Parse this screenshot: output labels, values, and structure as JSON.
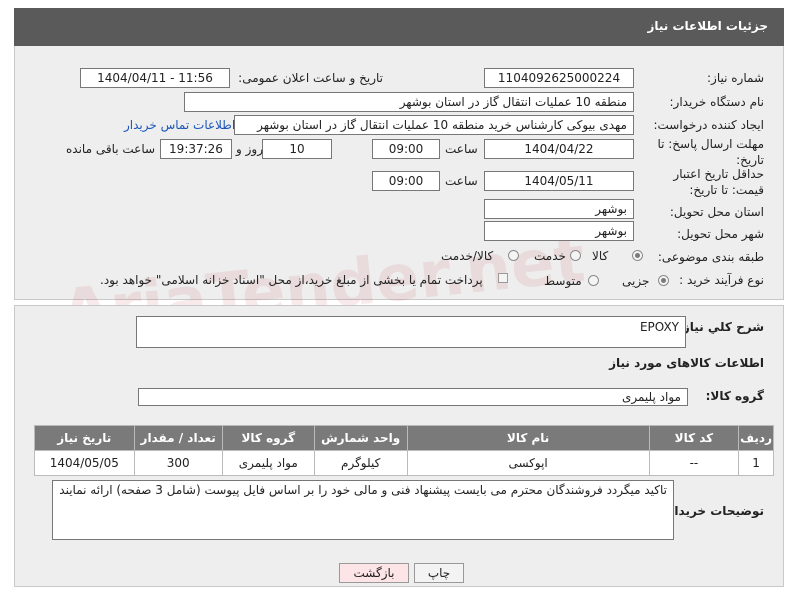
{
  "header": {
    "title": "جزئیات اطلاعات نیاز"
  },
  "form": {
    "need_number_label": "شماره نیاز:",
    "need_number": "1104092625000224",
    "announce_label": "تاریخ و ساعت اعلان عمومی:",
    "announce_value": "1404/04/11 - 11:56",
    "buyer_org_label": "نام دستگاه خریدار:",
    "buyer_org": "منطقه 10 عملیات انتقال گاز در استان بوشهر",
    "requester_label": "ایجاد کننده درخواست:",
    "requester": "مهدی بیوکی کارشناس خرید منطقه 10 عملیات انتقال گاز در استان بوشهر",
    "contact_link": "اطلاعات تماس خریدار",
    "reply_deadline_label": "مهلت ارسال پاسخ: تا تاریخ:",
    "reply_date": "1404/04/22",
    "time_label": "ساعت",
    "reply_time": "09:00",
    "days_value": "10",
    "days_label": "روز و",
    "remaining_time": "19:37:26",
    "remaining_label": "ساعت باقی مانده",
    "price_deadline_label": "حداقل تاریخ اعتبار قیمت: تا تاریخ:",
    "price_date": "1404/05/11",
    "price_time": "09:00",
    "province_label": "استان محل تحویل:",
    "province": "بوشهر",
    "city_label": "شهر محل تحویل:",
    "city": "بوشهر",
    "category_label": "طبقه بندی موضوعی:",
    "category_options": [
      "کالا",
      "خدمت",
      "کالا/خدمت"
    ],
    "process_label": "نوع فرآیند خرید :",
    "process_options": [
      "جزیی",
      "متوسط"
    ],
    "payment_note": "پرداخت تمام یا بخشی از مبلغ خرید،از محل \"اسناد خزانه اسلامی\" خواهد بود."
  },
  "summary": {
    "label": "شرح کلي نياز:",
    "value": "EPOXY"
  },
  "goods": {
    "section_title": "اطلاعات کالاهای مورد نیاز",
    "group_label": "گروه کالا:",
    "group_value": "مواد پلیمری",
    "columns": [
      "ردیف",
      "کد کالا",
      "نام کالا",
      "واحد شمارش",
      "گروه کالا",
      "تعداد / مقدار",
      "تاریخ نیاز"
    ],
    "rows": [
      [
        "1",
        "--",
        "اپوکسی",
        "کیلوگرم",
        "مواد پلیمری",
        "300",
        "1404/05/05"
      ]
    ]
  },
  "buyer_notes": {
    "label": "توضیحات خریدار:",
    "value": "تاکید میگردد فروشندگان محترم می بایست پیشنهاد فنی و مالی خود را بر اساس فایل پیوست (شامل 3 صفحه) ارائه نمایند"
  },
  "buttons": {
    "print": "چاپ",
    "back": "بازگشت"
  },
  "watermark": "AriaTender.net"
}
